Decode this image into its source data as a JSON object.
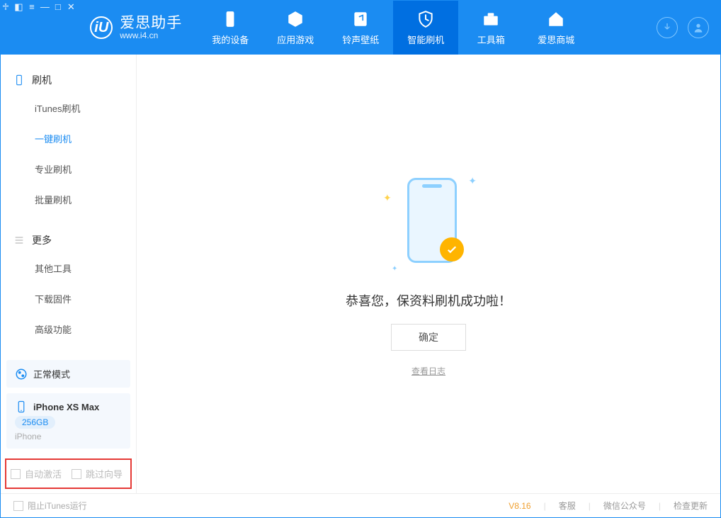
{
  "logo": {
    "title": "爱思助手",
    "subtitle": "www.i4.cn",
    "mark": "iU"
  },
  "window_controls": [
    "feedback",
    "skin",
    "menu",
    "minimize",
    "maximize",
    "close"
  ],
  "header_tabs": [
    {
      "label": "我的设备",
      "icon": "device"
    },
    {
      "label": "应用游戏",
      "icon": "cube"
    },
    {
      "label": "铃声壁纸",
      "icon": "music"
    },
    {
      "label": "智能刷机",
      "icon": "shield",
      "active": true
    },
    {
      "label": "工具箱",
      "icon": "toolbox"
    },
    {
      "label": "爱思商城",
      "icon": "home"
    }
  ],
  "sidebar": {
    "section1": {
      "title": "刷机",
      "items": [
        "iTunes刷机",
        "一键刷机",
        "专业刷机",
        "批量刷机"
      ],
      "active_index": 1
    },
    "section2": {
      "title": "更多",
      "items": [
        "其他工具",
        "下载固件",
        "高级功能"
      ]
    }
  },
  "devices": {
    "mode": {
      "label": "正常模式"
    },
    "phone": {
      "name": "iPhone XS Max",
      "storage": "256GB",
      "type": "iPhone"
    }
  },
  "options": {
    "auto_activate": "自动激活",
    "skip_guide": "跳过向导"
  },
  "main": {
    "success_text": "恭喜您，保资料刷机成功啦！",
    "ok_button": "确定",
    "view_log": "查看日志"
  },
  "footer": {
    "block_itunes": "阻止iTunes运行",
    "version": "V8.16",
    "links": [
      "客服",
      "微信公众号",
      "检查更新"
    ]
  }
}
